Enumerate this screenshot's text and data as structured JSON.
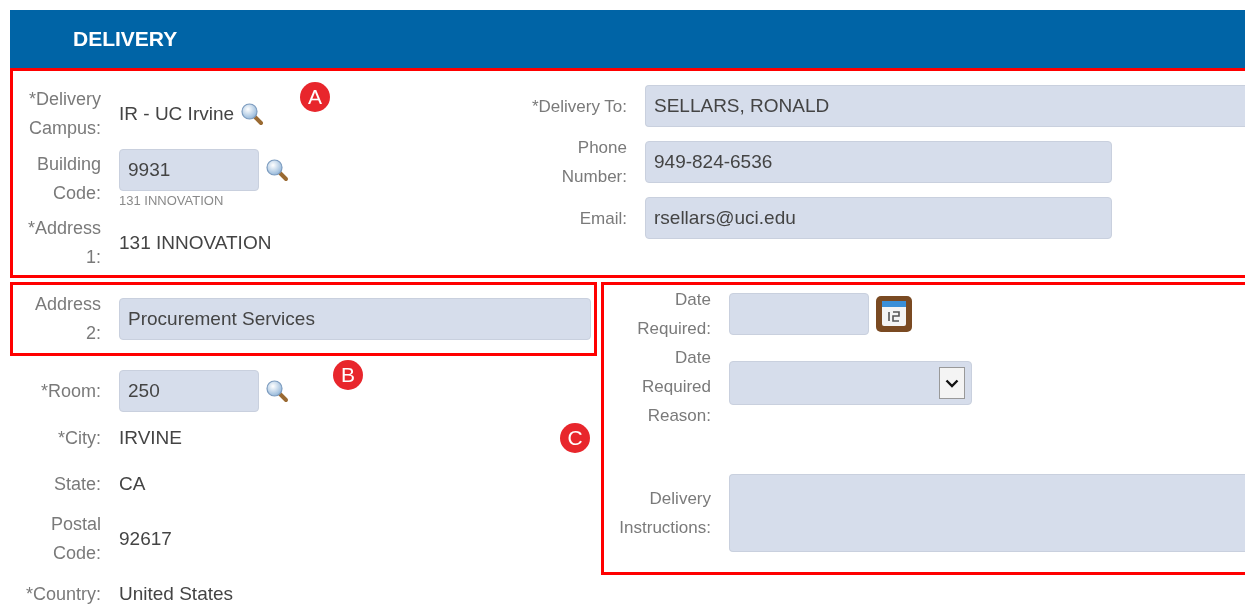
{
  "header": {
    "title": "DELIVERY"
  },
  "section_a": {
    "marker": "A",
    "left": [
      {
        "label": "*Delivery Campus:",
        "kind": "text",
        "value": "IR - UC Irvine",
        "lookup": true
      },
      {
        "label": "Building Code:",
        "kind": "input",
        "value": "9931",
        "lookup": true,
        "hint": "131 INNOVATION"
      },
      {
        "label": "*Address 1:",
        "kind": "text",
        "value": "131 INNOVATION",
        "lookup": false
      }
    ],
    "right": [
      {
        "label": "*Delivery To:",
        "kind": "wide",
        "value": "SELLARS, RONALD"
      },
      {
        "label": "Phone Number:",
        "kind": "long",
        "value": "949-824-6536"
      },
      {
        "label": "Email:",
        "kind": "long",
        "value": "rsellars@uci.edu"
      }
    ]
  },
  "section_b": {
    "marker": "B",
    "fields": [
      {
        "label": "Address 2:",
        "kind": "full",
        "value": "Procurement Services",
        "lookup": false
      }
    ]
  },
  "left_rest": [
    {
      "label": "*Room:",
      "kind": "input",
      "value": "250",
      "lookup": true
    },
    {
      "label": "*City:",
      "kind": "text",
      "value": "IRVINE",
      "lookup": false
    },
    {
      "label": "State:",
      "kind": "text",
      "value": "CA",
      "lookup": false
    },
    {
      "label": "Postal Code:",
      "kind": "text",
      "value": "92617",
      "lookup": false
    },
    {
      "label": "*Country:",
      "kind": "text",
      "value": "United States",
      "lookup": false
    }
  ],
  "section_c": {
    "marker": "C",
    "fields": [
      {
        "label": "Date Required:",
        "kind": "date"
      },
      {
        "label": "Date Required Reason:",
        "kind": "select"
      },
      {
        "label": "Delivery Instructions:",
        "kind": "textarea"
      }
    ]
  }
}
